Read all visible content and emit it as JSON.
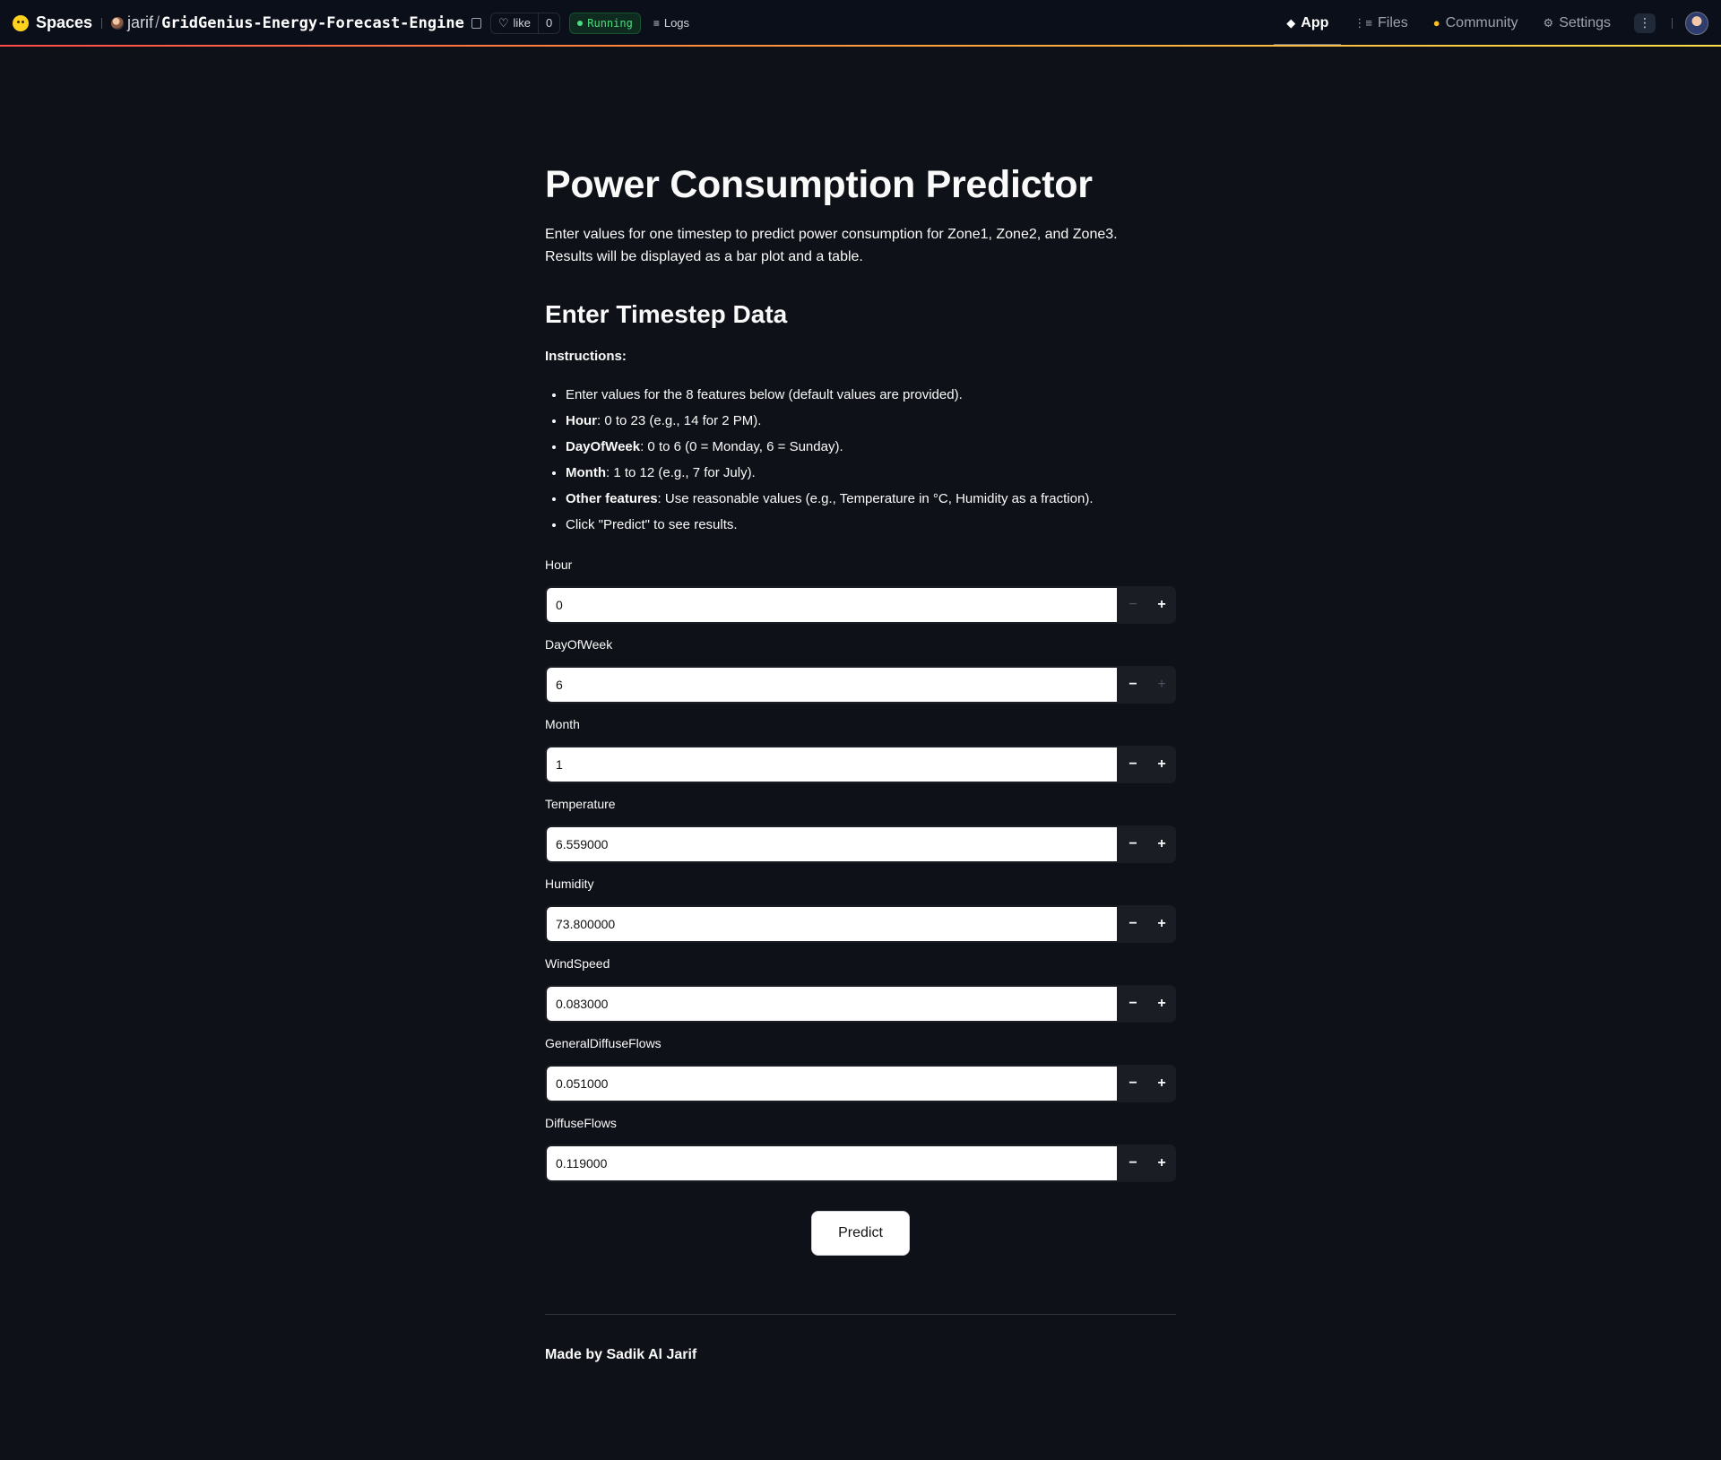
{
  "topbar": {
    "brand": "Spaces",
    "owner": "jarif",
    "repo_name": "GridGenius-Energy-Forecast-Engine",
    "like_label": "like",
    "like_count": "0",
    "status": "Running",
    "logs_label": "Logs",
    "nav": [
      {
        "label": "App",
        "icon": "app-icon",
        "active": true
      },
      {
        "label": "Files",
        "icon": "files-icon",
        "active": false
      },
      {
        "label": "Community",
        "icon": "community-icon",
        "active": false
      },
      {
        "label": "Settings",
        "icon": "gear-icon",
        "active": false
      }
    ],
    "accent_gradient": [
      "#ff4b4b",
      "#ff8c3b",
      "#fde047"
    ]
  },
  "main": {
    "title": "Power Consumption Predictor",
    "intro_line1": "Enter values for one timestep to predict power consumption for Zone1, Zone2, and Zone3.",
    "intro_line2": "Results will be displayed as a bar plot and a table.",
    "section_title": "Enter Timestep Data",
    "instructions_heading": "Instructions:",
    "instructions": [
      {
        "bold": "",
        "text": "Enter values for the 8 features below (default values are provided)."
      },
      {
        "bold": "Hour",
        "text": ": 0 to 23 (e.g., 14 for 2 PM)."
      },
      {
        "bold": "DayOfWeek",
        "text": ": 0 to 6 (0 = Monday, 6 = Sunday)."
      },
      {
        "bold": "Month",
        "text": ": 1 to 12 (e.g., 7 for July)."
      },
      {
        "bold": "Other features",
        "text": ": Use reasonable values (e.g., Temperature in °C, Humidity as a fraction)."
      },
      {
        "bold": "",
        "text": "Click \"Predict\" to see results."
      }
    ],
    "fields": [
      {
        "label": "Hour",
        "value": "0",
        "minus_disabled": true,
        "plus_disabled": false
      },
      {
        "label": "DayOfWeek",
        "value": "6",
        "minus_disabled": false,
        "plus_disabled": true
      },
      {
        "label": "Month",
        "value": "1",
        "minus_disabled": false,
        "plus_disabled": false
      },
      {
        "label": "Temperature",
        "value": "6.559000",
        "minus_disabled": false,
        "plus_disabled": false
      },
      {
        "label": "Humidity",
        "value": "73.800000",
        "minus_disabled": false,
        "plus_disabled": false
      },
      {
        "label": "WindSpeed",
        "value": "0.083000",
        "minus_disabled": false,
        "plus_disabled": false
      },
      {
        "label": "GeneralDiffuseFlows",
        "value": "0.051000",
        "minus_disabled": false,
        "plus_disabled": false
      },
      {
        "label": "DiffuseFlows",
        "value": "0.119000",
        "minus_disabled": false,
        "plus_disabled": false
      }
    ],
    "stepper_minus": "−",
    "stepper_plus": "+",
    "predict_label": "Predict",
    "footer_credit": "Made by Sadik Al Jarif"
  }
}
